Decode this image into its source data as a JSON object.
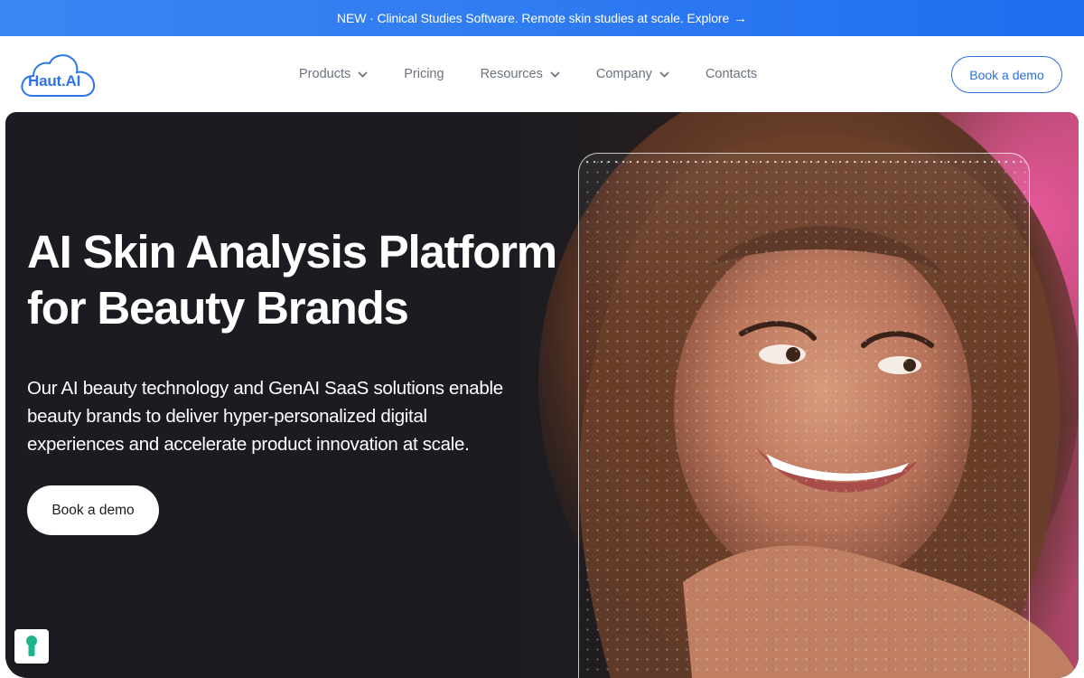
{
  "announcement": {
    "text": "NEW · Clinical Studies Software. Remote skin studies at scale. Explore",
    "arrow": "→"
  },
  "header": {
    "logo_text": "Haut.AI",
    "nav": [
      {
        "label": "Products",
        "has_dropdown": true
      },
      {
        "label": "Pricing",
        "has_dropdown": false
      },
      {
        "label": "Resources",
        "has_dropdown": true
      },
      {
        "label": "Company",
        "has_dropdown": true
      },
      {
        "label": "Contacts",
        "has_dropdown": false
      }
    ],
    "cta_label": "Book a demo"
  },
  "hero": {
    "title_line1": "AI Skin Analysis Platform",
    "title_line2": "for Beauty Brands",
    "subtitle_line1": "Our AI beauty technology and GenAI SaaS solutions enable",
    "subtitle_line2": "beauty brands to deliver hyper-personalized digital",
    "subtitle_line3": "experiences and accelerate product innovation at scale.",
    "cta_label": "Book a demo"
  },
  "colors": {
    "brand_blue": "#2d6fdd",
    "hero_bg": "#1b1c21",
    "accent_pink": "#f05aa0"
  },
  "icons": {
    "logo": "cloud-logo-icon",
    "dropdown": "chevron-down-icon",
    "widget": "keyhole-lock-icon"
  }
}
